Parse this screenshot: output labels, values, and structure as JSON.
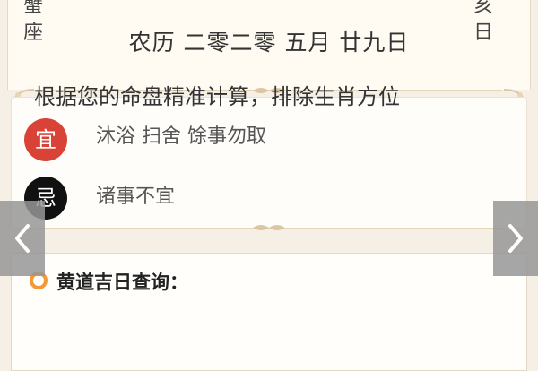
{
  "header": {
    "left_text": "蟹\n座",
    "left_line1": "蟹",
    "left_line2": "座",
    "right_line1": "亥",
    "right_line2": "日",
    "lunar_date": "农历 二零二零 五月 廿九日"
  },
  "almanac": {
    "yi_badge": "宜",
    "yi_text": "沐浴 扫舍 馀事勿取",
    "ji_badge": "忌",
    "ji_text": "诸事不宜"
  },
  "query": {
    "title": "黄道吉日查询：",
    "body": "根据您的命盘精准计算，排除生肖方位"
  },
  "nav": {
    "prev_icon": "chevron-left-icon",
    "next_icon": "chevron-right-icon"
  },
  "colors": {
    "yi": "#d84237",
    "ji": "#111111",
    "accent": "#f29a3b",
    "background": "#f5efe6"
  }
}
